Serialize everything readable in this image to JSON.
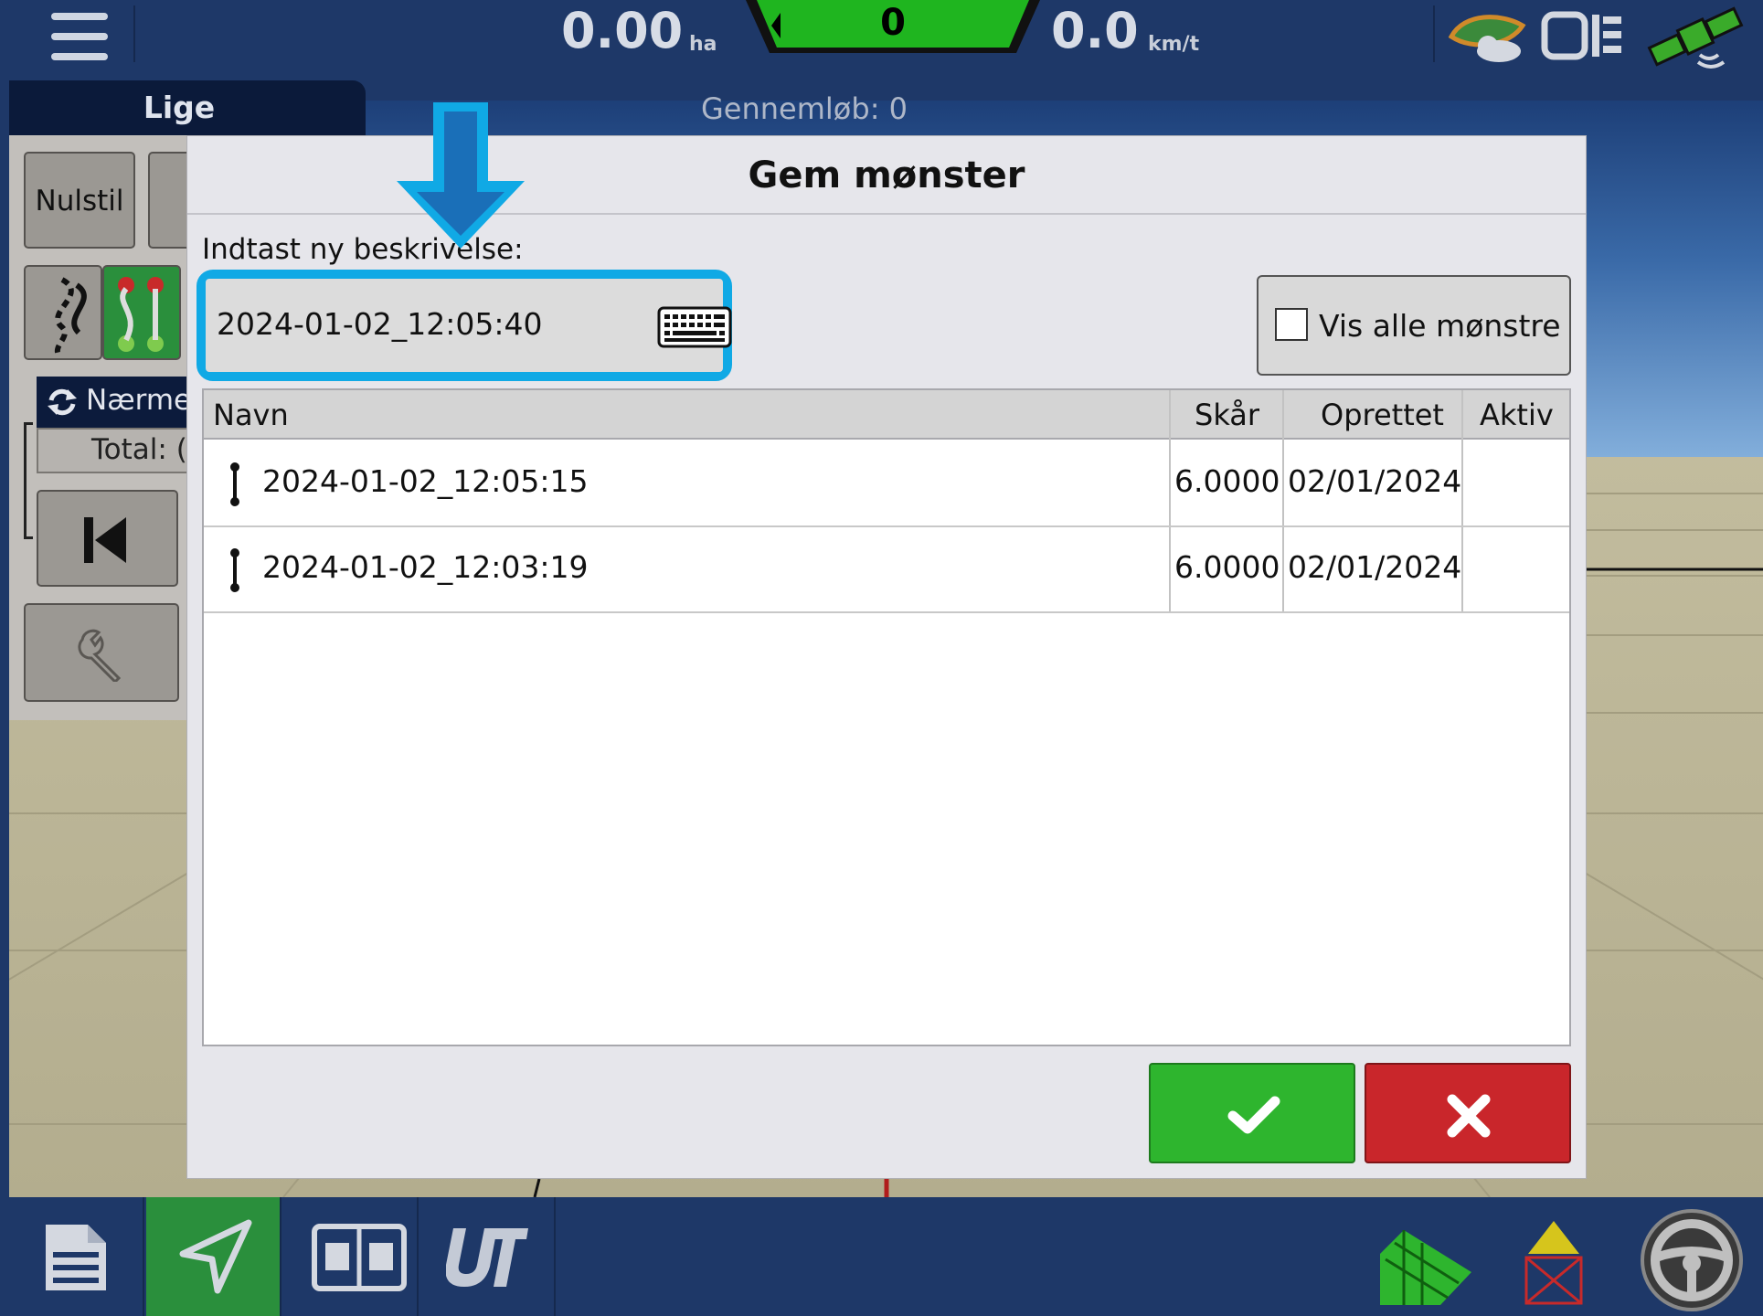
{
  "topbar": {
    "area_value": "0.00",
    "area_unit": "ha",
    "counter_value": "0",
    "speed_value": "0.0",
    "speed_unit": "km/t"
  },
  "left_panel": {
    "tab_label": "Lige",
    "passes_label": "Gennemløb: 0",
    "nulstil_label": "Nulstil",
    "naermeste_label": "Nærme",
    "total_label": "Total: ("
  },
  "dialog": {
    "title": "Gem mønster",
    "description_label": "Indtast ny beskrivelse:",
    "description_value": "2024-01-02_12:05:40",
    "show_all_label": "Vis alle mønstre",
    "show_all_checked": false,
    "table": {
      "headers": [
        "Navn",
        "Skår",
        "Oprettet",
        "Aktiv"
      ],
      "rows": [
        {
          "name": "2024-01-02_12:05:15",
          "swath": "6.0000",
          "created": "02/01/2024",
          "active": ""
        },
        {
          "name": "2024-01-02_12:03:19",
          "swath": "6.0000",
          "created": "02/01/2024",
          "active": ""
        }
      ]
    }
  },
  "colors": {
    "bar_blue": "#1e3868",
    "accent_green": "#2eb52e",
    "cancel_red": "#c9262b",
    "highlight_cyan": "#10a9e5"
  },
  "icons": {
    "menu": "hamburger-icon",
    "keyboard": "keyboard-icon",
    "ok": "checkmark-icon",
    "cancel": "x-icon",
    "pattern_line": "ab-line-icon"
  }
}
